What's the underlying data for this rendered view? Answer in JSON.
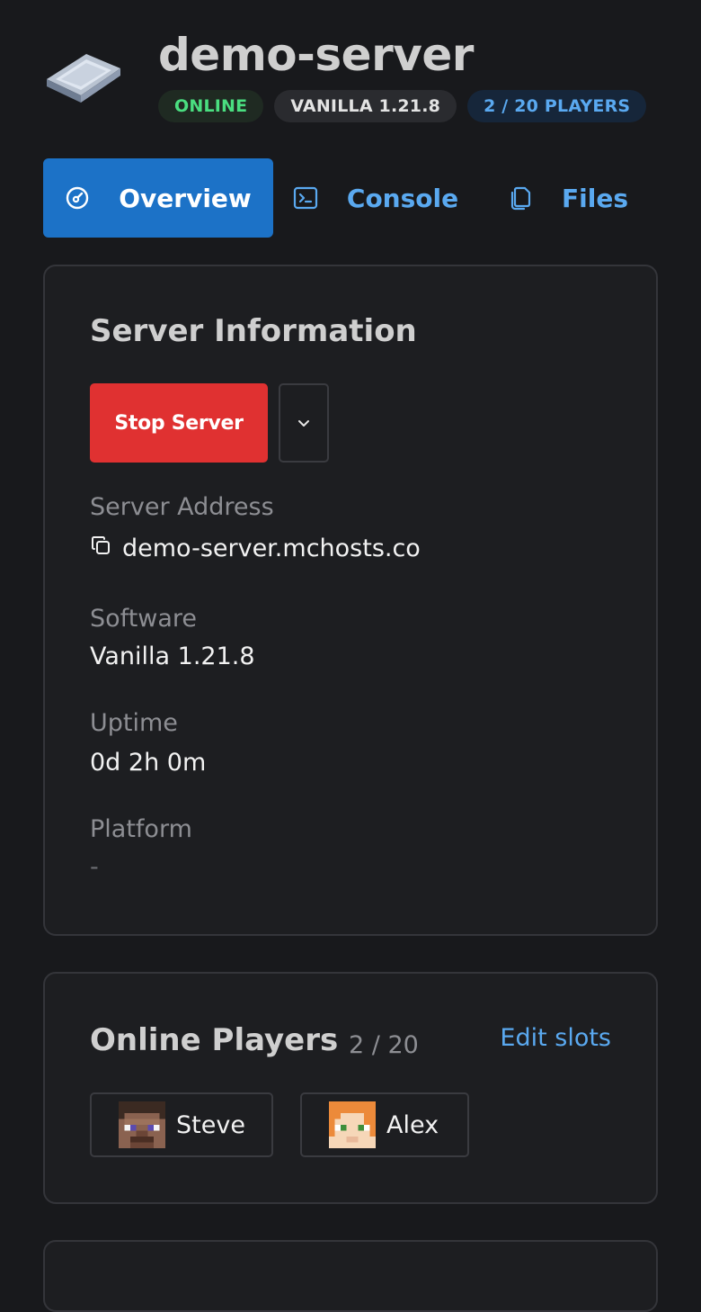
{
  "header": {
    "title": "demo-server",
    "badges": {
      "status": "ONLINE",
      "version": "VANILLA 1.21.8",
      "players": "2 / 20 PLAYERS"
    },
    "icon": "iron-ingot-icon"
  },
  "tabs": [
    {
      "label": "Overview",
      "icon": "gauge-icon",
      "active": true
    },
    {
      "label": "Console",
      "icon": "terminal-icon",
      "active": false
    },
    {
      "label": "Files",
      "icon": "files-icon",
      "active": false
    }
  ],
  "server_info": {
    "title": "Server Information",
    "stop_label": "Stop Server",
    "fields": {
      "address": {
        "label": "Server Address",
        "value": "demo-server.mchosts.co"
      },
      "software": {
        "label": "Software",
        "value": "Vanilla 1.21.8"
      },
      "uptime": {
        "label": "Uptime",
        "value": "0d 2h 0m"
      },
      "platform": {
        "label": "Platform",
        "value": "-"
      }
    }
  },
  "players": {
    "title": "Online Players",
    "count": "2 / 20",
    "edit_label": "Edit slots",
    "list": [
      {
        "name": "Steve"
      },
      {
        "name": "Alex"
      }
    ]
  },
  "colors": {
    "background": "#18191c",
    "card": "#1d1e21",
    "accent_blue": "#1c72c7",
    "link_blue": "#5aa9f0",
    "danger": "#e03131",
    "online_green": "#4ade80"
  }
}
